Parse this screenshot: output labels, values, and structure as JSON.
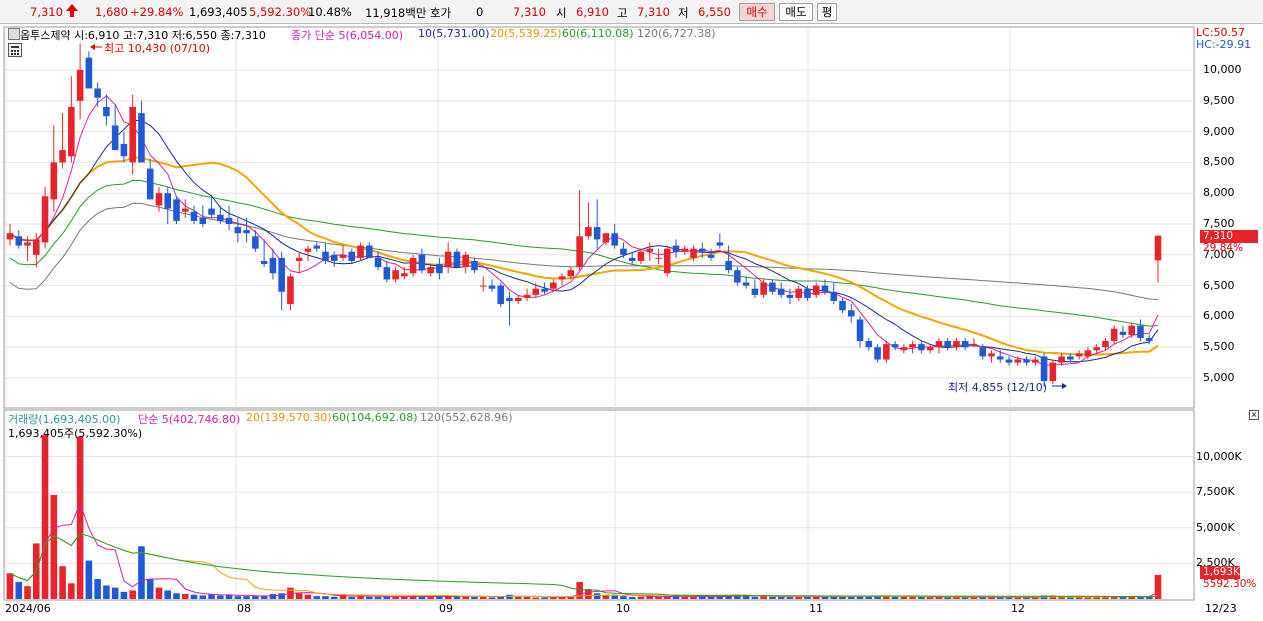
{
  "quote": {
    "price": "7,310",
    "up_arrow": "arrow-up-icon",
    "change": "1,680",
    "change_pct": "+29.84%",
    "volume": "1,693,405",
    "volume_ratio": "5,592.30%",
    "turnover_pct": "10.48%",
    "trade_value": "11,918백만",
    "hoga_label": "호가",
    "hoga_value": "0",
    "hoga_price": "7,310",
    "open_label": "시",
    "open_value": "6,910",
    "high_label": "고",
    "high_value": "7,310",
    "low_label": "저",
    "low_value": "6,550"
  },
  "buttons": {
    "buy": "매수",
    "sell": "매도",
    "eval": "평"
  },
  "colors": {
    "up": "#e8232a",
    "down": "#1e5ad6",
    "ma5": "#d020b0",
    "ma10": "#1a2a8a",
    "ma20": "#f0a800",
    "ma60": "#2a9a2a",
    "ma120": "#777777"
  },
  "price_panel": {
    "header": "옵투스제약 시:6,910 고:7,310 저:6,550 종:7,310",
    "ma_label_main": "종가 단순 5(6,054.00)",
    "ma10_label": "10(5,731.00)",
    "ma20_label": "20(5,539.25)",
    "ma60_label": "60(6,110.08)",
    "ma120_label": "120(6,727.38)",
    "lc": "LC:50.57",
    "hc": "HC:-29.91",
    "high_annot": "최고 10,430 (07/10)",
    "low_annot": "최저 4,855 (12/10)",
    "last_price_tag": "7,310",
    "last_pct_tag": "29.84%",
    "y_ticks": [
      "10,000",
      "9,500",
      "9,000",
      "8,500",
      "8,000",
      "7,500",
      "7,000",
      "6,500",
      "6,000",
      "5,500",
      "5,000"
    ]
  },
  "volume_panel": {
    "header_main": "거래량(1,693,405.00)",
    "header_ma5": "단순 5(402,746.80)",
    "header_ma20": "20(139,570.30)",
    "header_ma60": "60(104,692.08)",
    "header_ma120": "120(552,628.96)",
    "sub_header": "1,693,405주(5,592.30%)",
    "last_tag": "1,693K",
    "last_pct": "5592.30%",
    "y_ticks": [
      "10,000K",
      "7,500K",
      "5,000K",
      "2,500K"
    ]
  },
  "x_axis": {
    "labels": [
      "2024/06",
      "08",
      "09",
      "10",
      "11",
      "12"
    ],
    "right_label": "12/23"
  },
  "chart_data": {
    "type": "candlestick",
    "ylim": [
      4500,
      10500
    ],
    "volume_ylim": [
      0,
      12000
    ],
    "candles": [
      [
        7250,
        7500,
        7150,
        7350,
        1800
      ],
      [
        7300,
        7400,
        7100,
        7150,
        1200
      ],
      [
        7150,
        7300,
        6900,
        7200,
        900
      ],
      [
        7000,
        7350,
        6800,
        7250,
        3900
      ],
      [
        7200,
        8100,
        7100,
        7950,
        11500
      ],
      [
        7900,
        9100,
        7700,
        8500,
        7300
      ],
      [
        8500,
        9300,
        8400,
        8700,
        2300
      ],
      [
        8600,
        9900,
        8500,
        9400,
        1100
      ],
      [
        9500,
        10430,
        9200,
        10000,
        11400
      ],
      [
        10200,
        10300,
        9700,
        9700,
        2700
      ],
      [
        9700,
        9800,
        9400,
        9550,
        1400
      ],
      [
        9400,
        9600,
        9100,
        9250,
        950
      ],
      [
        9100,
        9450,
        8700,
        8700,
        800
      ],
      [
        8800,
        9000,
        8500,
        8600,
        500
      ],
      [
        8500,
        9600,
        8300,
        9400,
        600
      ],
      [
        9300,
        9500,
        8500,
        8500,
        3700
      ],
      [
        8400,
        8550,
        7900,
        7900,
        1400
      ],
      [
        7800,
        8100,
        7700,
        8000,
        800
      ],
      [
        8000,
        8100,
        7500,
        7750,
        600
      ],
      [
        7900,
        7950,
        7500,
        7550,
        400
      ],
      [
        7700,
        7900,
        7600,
        7750,
        350
      ],
      [
        7700,
        7800,
        7500,
        7550,
        300
      ],
      [
        7600,
        7800,
        7450,
        7500,
        250
      ],
      [
        7750,
        7950,
        7600,
        7650,
        350
      ],
      [
        7650,
        7800,
        7500,
        7550,
        250
      ],
      [
        7600,
        7800,
        7400,
        7500,
        300
      ],
      [
        7450,
        7600,
        7200,
        7350,
        200
      ],
      [
        7400,
        7600,
        7200,
        7350,
        200
      ],
      [
        7300,
        7400,
        7050,
        7100,
        200
      ],
      [
        6900,
        7250,
        6800,
        6850,
        200
      ],
      [
        6950,
        7100,
        6600,
        6700,
        350
      ],
      [
        6950,
        7050,
        6100,
        6400,
        400
      ],
      [
        6200,
        6700,
        6100,
        6650,
        800
      ],
      [
        6900,
        7050,
        6700,
        6950,
        400
      ],
      [
        7050,
        7150,
        6900,
        7100,
        300
      ],
      [
        7150,
        7200,
        7050,
        7100,
        200
      ],
      [
        7050,
        7200,
        6850,
        6900,
        200
      ],
      [
        7000,
        7050,
        6800,
        6900,
        150
      ],
      [
        6950,
        7150,
        6900,
        7000,
        350
      ],
      [
        7050,
        7100,
        6850,
        6900,
        150
      ],
      [
        6950,
        7200,
        6900,
        7150,
        200
      ],
      [
        7150,
        7200,
        6950,
        6950,
        150
      ],
      [
        6950,
        7050,
        6750,
        6800,
        150
      ],
      [
        6800,
        6900,
        6550,
        6600,
        200
      ],
      [
        6600,
        6800,
        6550,
        6750,
        150
      ],
      [
        6650,
        6800,
        6600,
        6700,
        200
      ],
      [
        6700,
        7000,
        6650,
        6950,
        200
      ],
      [
        7000,
        7100,
        6700,
        6750,
        150
      ],
      [
        6700,
        6850,
        6650,
        6800,
        150
      ],
      [
        6850,
        6950,
        6600,
        6700,
        200
      ],
      [
        6800,
        7200,
        6700,
        7050,
        200
      ],
      [
        7050,
        7100,
        6800,
        6800,
        200
      ],
      [
        6800,
        7050,
        6700,
        7000,
        200
      ],
      [
        6900,
        6950,
        6700,
        6750,
        150
      ],
      [
        6500,
        6650,
        6400,
        6500,
        150
      ],
      [
        6500,
        6600,
        6400,
        6450,
        100
      ],
      [
        6500,
        6550,
        6150,
        6200,
        200
      ],
      [
        6300,
        6400,
        5850,
        6250,
        300
      ],
      [
        6250,
        6350,
        6200,
        6300,
        150
      ],
      [
        6300,
        6450,
        6250,
        6350,
        150
      ],
      [
        6350,
        6550,
        6300,
        6450,
        100
      ],
      [
        6450,
        6550,
        6350,
        6400,
        100
      ],
      [
        6450,
        6600,
        6400,
        6550,
        100
      ],
      [
        6600,
        6700,
        6500,
        6650,
        150
      ],
      [
        6650,
        6800,
        6600,
        6750,
        200
      ],
      [
        6800,
        8050,
        6750,
        7300,
        1200
      ],
      [
        7300,
        7850,
        7250,
        7450,
        700
      ],
      [
        7450,
        7900,
        7100,
        7250,
        400
      ],
      [
        7200,
        7350,
        7150,
        7350,
        300
      ],
      [
        7350,
        7500,
        7100,
        7150,
        300
      ],
      [
        7100,
        7200,
        6950,
        7000,
        200
      ],
      [
        6950,
        7050,
        6850,
        6900,
        150
      ],
      [
        6900,
        7100,
        6850,
        7050,
        150
      ],
      [
        7050,
        7200,
        6900,
        7100,
        200
      ],
      [
        6950,
        7100,
        6850,
        6950,
        150
      ],
      [
        6700,
        7150,
        6650,
        7100,
        200
      ],
      [
        7150,
        7250,
        6950,
        7050,
        250
      ],
      [
        7050,
        7150,
        7000,
        7100,
        150
      ],
      [
        6950,
        7150,
        6900,
        7100,
        150
      ],
      [
        7100,
        7200,
        6950,
        7050,
        150
      ],
      [
        7000,
        7100,
        6900,
        6950,
        150
      ],
      [
        7200,
        7350,
        7100,
        7150,
        200
      ],
      [
        6900,
        7150,
        6700,
        6750,
        300
      ],
      [
        6750,
        6800,
        6500,
        6550,
        250
      ],
      [
        6550,
        6650,
        6450,
        6500,
        200
      ],
      [
        6450,
        6600,
        6300,
        6350,
        150
      ],
      [
        6350,
        6600,
        6300,
        6550,
        200
      ],
      [
        6550,
        6600,
        6350,
        6400,
        150
      ],
      [
        6450,
        6550,
        6300,
        6350,
        150
      ],
      [
        6350,
        6450,
        6200,
        6300,
        150
      ],
      [
        6300,
        6500,
        6250,
        6450,
        150
      ],
      [
        6450,
        6500,
        6250,
        6300,
        150
      ],
      [
        6350,
        6550,
        6300,
        6500,
        200
      ],
      [
        6500,
        6600,
        6350,
        6400,
        150
      ],
      [
        6400,
        6550,
        6200,
        6250,
        150
      ],
      [
        6250,
        6300,
        6050,
        6100,
        150
      ],
      [
        6100,
        6200,
        5900,
        6000,
        150
      ],
      [
        5950,
        6000,
        5500,
        5600,
        250
      ],
      [
        5600,
        5650,
        5450,
        5500,
        200
      ],
      [
        5500,
        5550,
        5250,
        5300,
        250
      ],
      [
        5300,
        5600,
        5250,
        5550,
        200
      ],
      [
        5550,
        5600,
        5450,
        5500,
        150
      ],
      [
        5450,
        5550,
        5400,
        5500,
        150
      ],
      [
        5500,
        5600,
        5400,
        5550,
        150
      ],
      [
        5550,
        5600,
        5400,
        5450,
        150
      ],
      [
        5450,
        5550,
        5400,
        5500,
        100
      ],
      [
        5500,
        5650,
        5400,
        5600,
        150
      ],
      [
        5600,
        5650,
        5450,
        5500,
        100
      ],
      [
        5500,
        5650,
        5450,
        5600,
        150
      ],
      [
        5600,
        5650,
        5450,
        5500,
        100
      ],
      [
        5550,
        5650,
        5500,
        5550,
        100
      ],
      [
        5500,
        5550,
        5300,
        5350,
        150
      ],
      [
        5350,
        5450,
        5250,
        5400,
        150
      ],
      [
        5350,
        5450,
        5250,
        5300,
        100
      ],
      [
        5300,
        5350,
        5200,
        5250,
        100
      ],
      [
        5250,
        5350,
        5200,
        5300,
        100
      ],
      [
        5300,
        5350,
        5200,
        5250,
        100
      ],
      [
        5250,
        5350,
        5200,
        5300,
        100
      ],
      [
        5350,
        5400,
        4855,
        4950,
        250
      ],
      [
        4950,
        5300,
        4900,
        5250,
        250
      ],
      [
        5250,
        5400,
        5200,
        5350,
        150
      ],
      [
        5350,
        5400,
        5250,
        5300,
        100
      ],
      [
        5350,
        5450,
        5300,
        5400,
        150
      ],
      [
        5350,
        5500,
        5300,
        5450,
        100
      ],
      [
        5450,
        5550,
        5400,
        5500,
        150
      ],
      [
        5500,
        5650,
        5450,
        5600,
        200
      ],
      [
        5600,
        5850,
        5550,
        5800,
        200
      ],
      [
        5750,
        5850,
        5650,
        5700,
        200
      ],
      [
        5700,
        5900,
        5650,
        5850,
        150
      ],
      [
        5850,
        5950,
        5600,
        5650,
        150
      ],
      [
        5650,
        5700,
        5550,
        5600,
        150
      ],
      [
        6910,
        7310,
        6550,
        7310,
        1693
      ]
    ],
    "moving_averages_close": {
      "ma5": 6054.0,
      "ma10": 5731.0,
      "ma20": 5539.25,
      "ma60": 6110.08,
      "ma120": 6727.38
    },
    "volume_moving_averages": {
      "ma5": 402746.8,
      "ma20": 139570.3,
      "ma60": 104692.08,
      "ma120": 552628.96
    }
  }
}
